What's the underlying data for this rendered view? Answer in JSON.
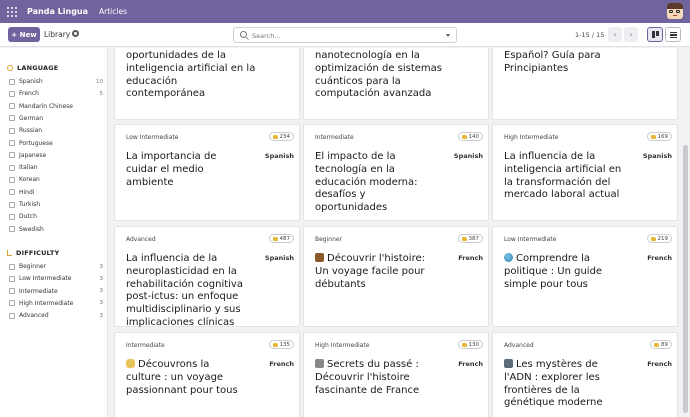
{
  "app": {
    "name": "Panda Lingua",
    "nav": [
      "Articles"
    ]
  },
  "toolbar": {
    "new_label": "New",
    "breadcrumb": "Library",
    "search_placeholder": "Search...",
    "pager_value": "1-15 / 15",
    "prev_glyph": "‹",
    "next_glyph": "›"
  },
  "sidebar": {
    "language_header": "LANGUAGE",
    "languages": [
      {
        "label": "Spanish",
        "count": "10"
      },
      {
        "label": "French",
        "count": "5"
      },
      {
        "label": "Mandarin Chinese",
        "count": ""
      },
      {
        "label": "German",
        "count": ""
      },
      {
        "label": "Russian",
        "count": ""
      },
      {
        "label": "Portuguese",
        "count": ""
      },
      {
        "label": "Japanese",
        "count": ""
      },
      {
        "label": "Italian",
        "count": ""
      },
      {
        "label": "Korean",
        "count": ""
      },
      {
        "label": "Hindi",
        "count": ""
      },
      {
        "label": "Turkish",
        "count": ""
      },
      {
        "label": "Dutch",
        "count": ""
      },
      {
        "label": "Swedish",
        "count": ""
      }
    ],
    "difficulty_header": "DIFFICULTY",
    "difficulties": [
      {
        "label": "Beginner",
        "count": "3"
      },
      {
        "label": "Low Intermediate",
        "count": "3"
      },
      {
        "label": "Intermediate",
        "count": "3"
      },
      {
        "label": "High Intermediate",
        "count": "3"
      },
      {
        "label": "Advanced",
        "count": "3"
      }
    ]
  },
  "cards_top": [
    {
      "title": "oportunidades de la inteligencia artificial en la educación contemporánea"
    },
    {
      "title": "nanotecnología en la optimización de sistemas cuánticos para la computación avanzada"
    },
    {
      "title": "Español? Guía para Principiantes"
    }
  ],
  "cards": [
    {
      "level": "Low Intermediate",
      "likes": "234",
      "lang": "Spanish",
      "emoji": "",
      "title": "La importancia de cuidar el medio ambiente"
    },
    {
      "level": "Intermediate",
      "likes": "140",
      "lang": "Spanish",
      "emoji": "",
      "title": "El impacto de la tecnología en la educación moderna: desafíos y oportunidades"
    },
    {
      "level": "High Intermediate",
      "likes": "169",
      "lang": "Spanish",
      "emoji": "",
      "title": "La influencia de la inteligencia artificial en la transformación del mercado laboral actual"
    },
    {
      "level": "Advanced",
      "likes": "487",
      "lang": "Spanish",
      "emoji": "",
      "title": "La influencia de la neuroplasticidad en la rehabilitación cognitiva post-ictus: un enfoque multidisciplinario y sus implicaciones clínicas"
    },
    {
      "level": "Beginner",
      "likes": "387",
      "lang": "French",
      "emoji": "book-icon",
      "title": "Découvrir l'histoire: Un voyage facile pour débutants"
    },
    {
      "level": "Low Intermediate",
      "likes": "219",
      "lang": "French",
      "emoji": "globe-icon",
      "title": "Comprendre la politique : Un guide simple pour tous"
    },
    {
      "level": "Intermediate",
      "likes": "135",
      "lang": "French",
      "emoji": "theater-icon",
      "title": "Découvrons la culture : un voyage passionnant pour tous"
    },
    {
      "level": "High Intermediate",
      "likes": "130",
      "lang": "French",
      "emoji": "temple-icon",
      "title": "Secrets du passé : Découvrir l'histoire fascinante de France"
    },
    {
      "level": "Advanced",
      "likes": "89",
      "lang": "French",
      "emoji": "microscope-icon",
      "title": "Les mystères de l'ADN : explorer les frontières de la génétique moderne"
    }
  ]
}
